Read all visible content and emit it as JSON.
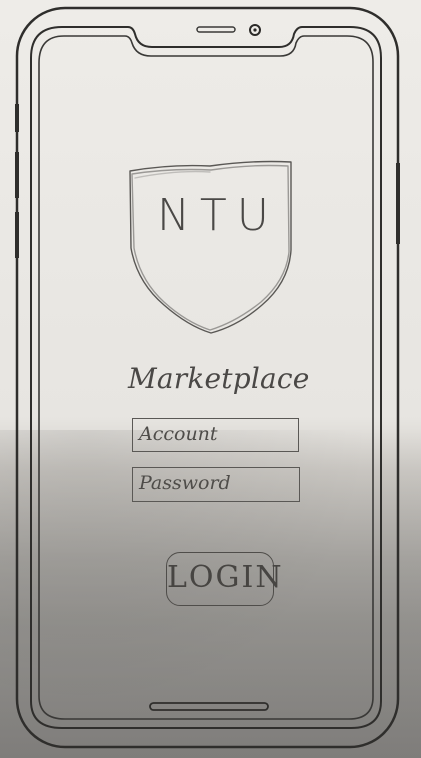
{
  "logo": {
    "text": "NTU"
  },
  "app": {
    "title": "Marketplace"
  },
  "form": {
    "account_placeholder": "Account",
    "password_placeholder": "Password",
    "login_label": "LOGIN"
  },
  "colors": {
    "paper": "#eeece8",
    "ink": "#4a4846"
  },
  "icons": [
    "shield-icon",
    "camera-icon"
  ]
}
